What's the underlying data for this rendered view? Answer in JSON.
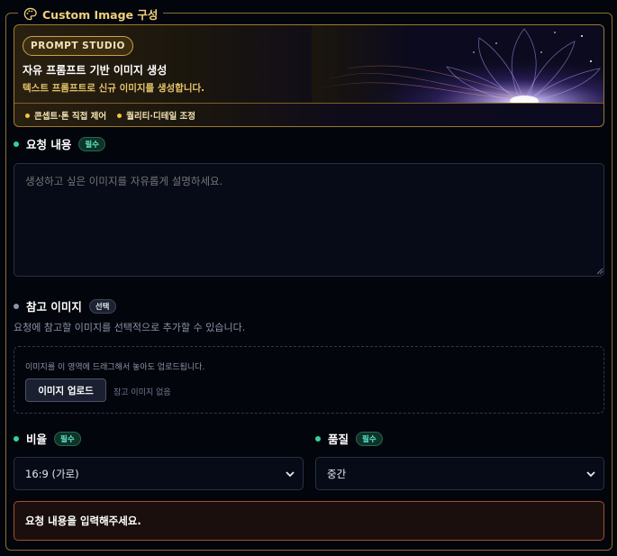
{
  "section": {
    "title": "Custom Image 구성"
  },
  "hero": {
    "badge": "PROMPT STUDIO",
    "title": "자유 프롬프트 기반 이미지 생성",
    "subtitle": "텍스트 프롬프트로 신규 이미지를 생성합니다.",
    "tags": [
      "콘셉트·톤 직접 제어",
      "퀄리티·디테일 조정"
    ]
  },
  "request": {
    "label": "요청 내용",
    "badge": "필수",
    "placeholder": "생성하고 싶은 이미지를 자유롭게 설명하세요.",
    "value": ""
  },
  "reference": {
    "label": "참고 이미지",
    "badge": "선택",
    "help": "요청에 참고할 이미지를 선택적으로 추가할 수 있습니다.",
    "drop_hint": "이미지를 이 영역에 드래그해서 놓아도 업로드됩니다.",
    "upload_button": "이미지 업로드",
    "empty_text": "참고 이미지 없음"
  },
  "ratio": {
    "label": "비율",
    "badge": "필수",
    "selected": "16:9 (가로)"
  },
  "quality": {
    "label": "품질",
    "badge": "필수",
    "selected": "중간"
  },
  "alert": {
    "message": "요청 내용을 입력해주세요."
  },
  "icons": {
    "section": "palette-icon",
    "select_arrow": "chevron-down-icon",
    "hero_art": "glowing-lotus-illustration"
  },
  "colors": {
    "accent_gold": "#f2d07a",
    "required_green": "#34d399",
    "alert_border": "#a0522d"
  }
}
